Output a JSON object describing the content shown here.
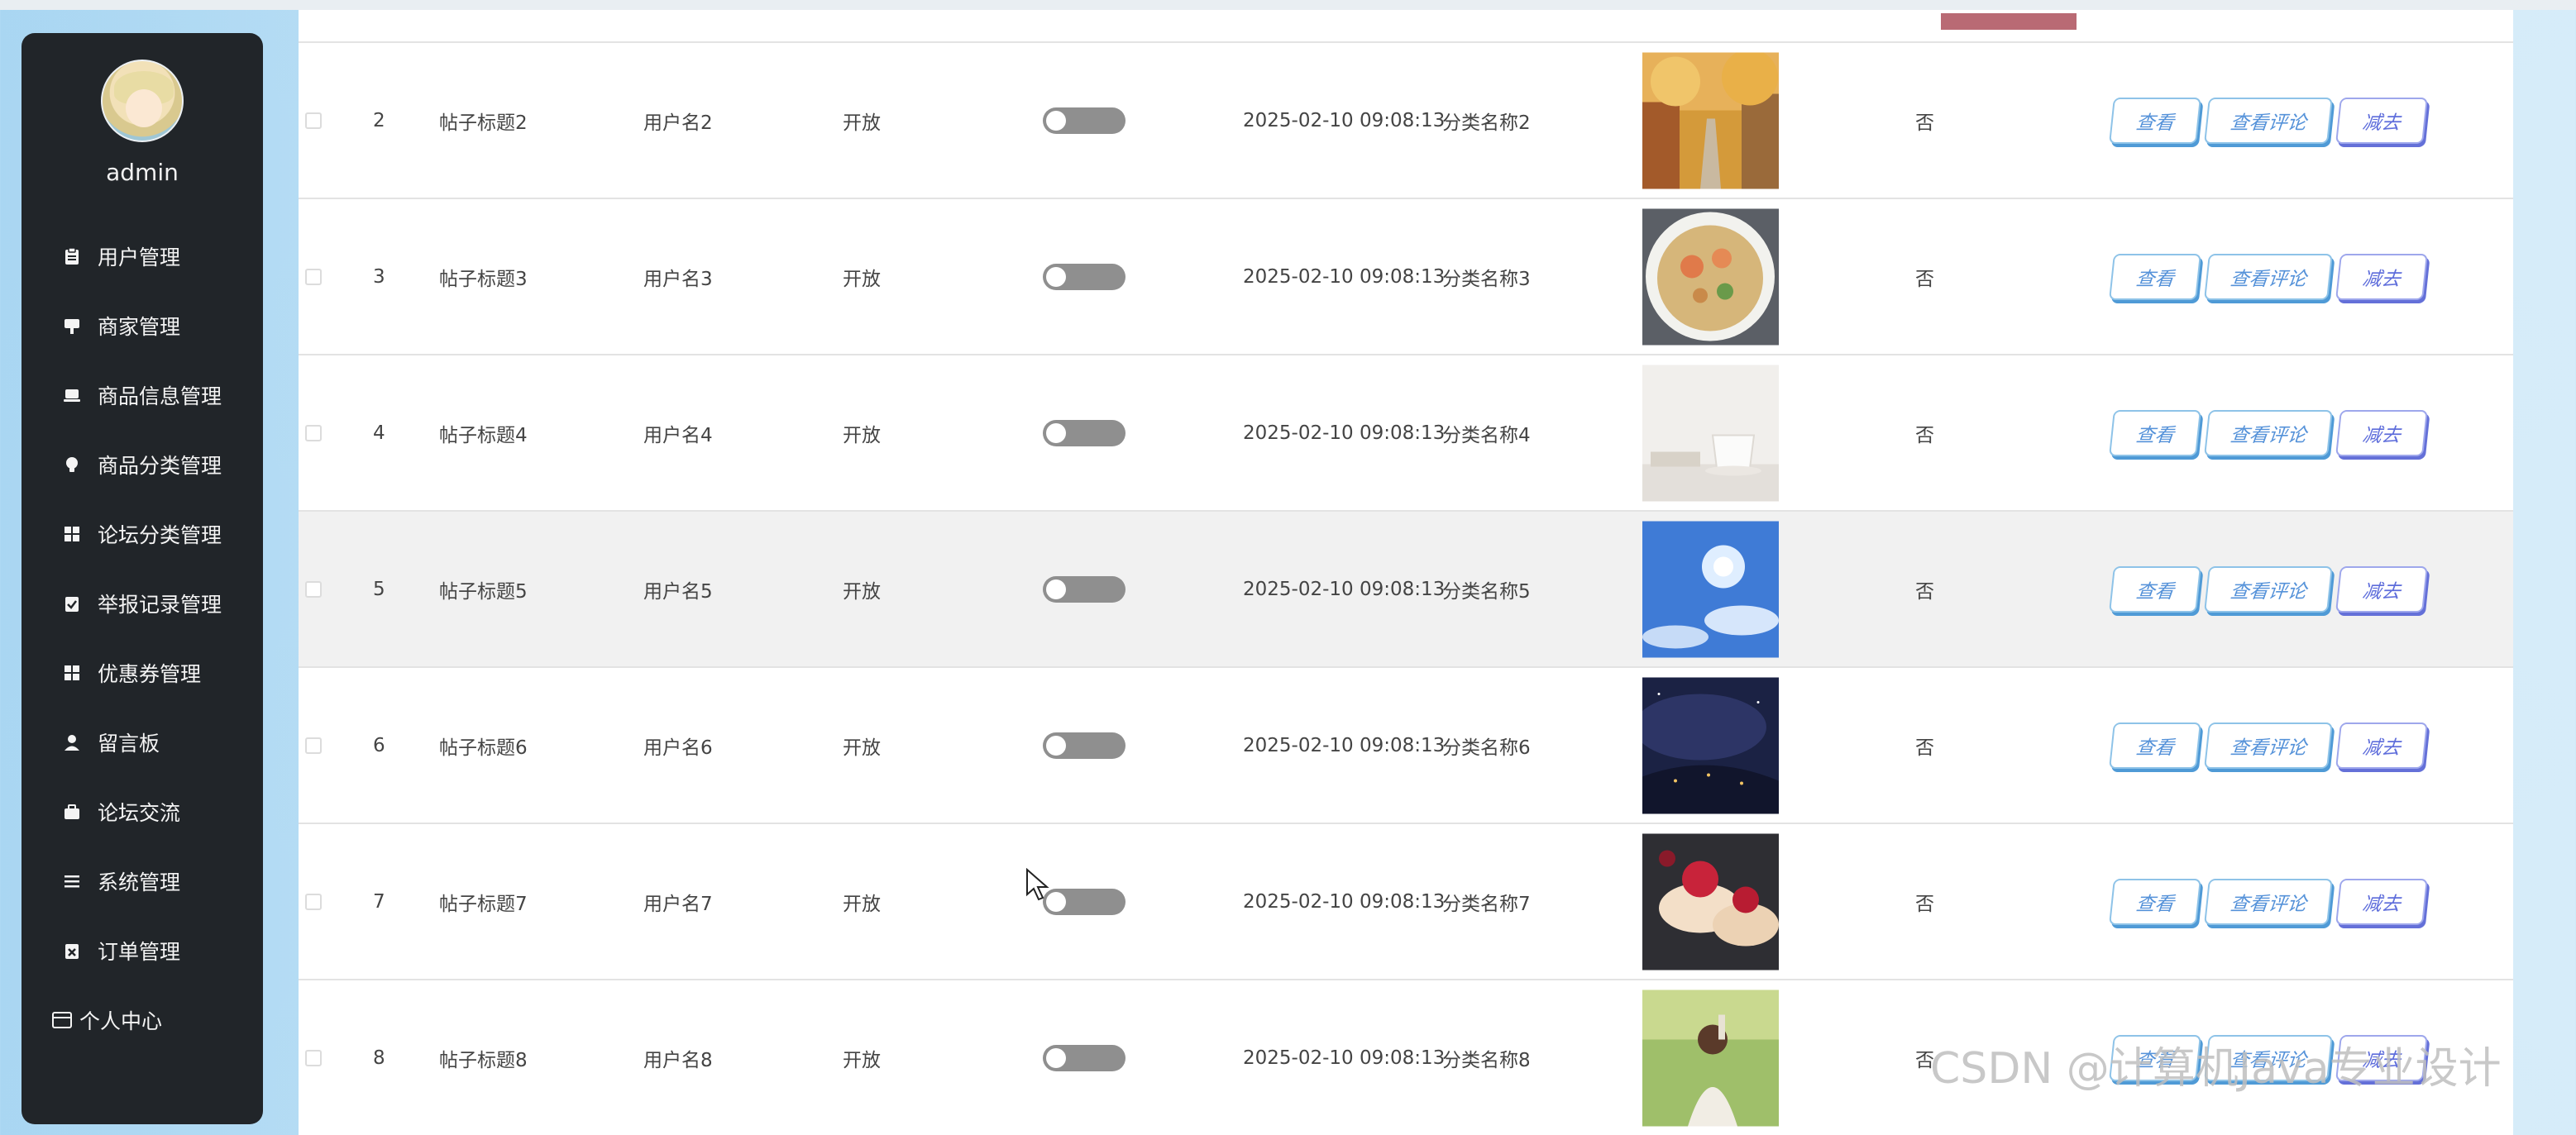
{
  "sidebar": {
    "username": "admin",
    "items": [
      {
        "label": "用户管理",
        "icon": "clipboard-icon"
      },
      {
        "label": "商家管理",
        "icon": "sign-icon"
      },
      {
        "label": "商品信息管理",
        "icon": "laptop-icon"
      },
      {
        "label": "商品分类管理",
        "icon": "bulb-icon"
      },
      {
        "label": "论坛分类管理",
        "icon": "grid-icon"
      },
      {
        "label": "举报记录管理",
        "icon": "clipboard-check-icon"
      },
      {
        "label": "优惠券管理",
        "icon": "grid-icon"
      },
      {
        "label": "留言板",
        "icon": "user-icon"
      },
      {
        "label": "论坛交流",
        "icon": "briefcase-icon"
      },
      {
        "label": "系统管理",
        "icon": "list-icon"
      },
      {
        "label": "订单管理",
        "icon": "clipboard-x-icon"
      },
      {
        "label": "个人中心",
        "icon": "window-icon"
      }
    ]
  },
  "table": {
    "button_labels": {
      "view": "查看",
      "comments": "查看评论",
      "minus": "减去"
    },
    "rows": [
      {
        "index": "2",
        "title": "帖子标题2",
        "user": "用户名2",
        "status": "开放",
        "toggle_on": false,
        "time": "2025-02-10 09:08:13",
        "category": "分类名称2",
        "image": "autumn-path",
        "pinned": "否"
      },
      {
        "index": "3",
        "title": "帖子标题3",
        "user": "用户名3",
        "status": "开放",
        "toggle_on": false,
        "time": "2025-02-10 09:08:13",
        "category": "分类名称3",
        "image": "noodle-bowl",
        "pinned": "否"
      },
      {
        "index": "4",
        "title": "帖子标题4",
        "user": "用户名4",
        "status": "开放",
        "toggle_on": false,
        "time": "2025-02-10 09:08:13",
        "category": "分类名称4",
        "image": "coffee-cup",
        "pinned": "否"
      },
      {
        "index": "5",
        "title": "帖子标题5",
        "user": "用户名5",
        "status": "开放",
        "toggle_on": false,
        "time": "2025-02-10 09:08:13",
        "category": "分类名称5",
        "image": "blue-sky",
        "pinned": "否"
      },
      {
        "index": "6",
        "title": "帖子标题6",
        "user": "用户名6",
        "status": "开放",
        "toggle_on": false,
        "time": "2025-02-10 09:08:13",
        "category": "分类名称6",
        "image": "night-space",
        "pinned": "否"
      },
      {
        "index": "7",
        "title": "帖子标题7",
        "user": "用户名7",
        "status": "开放",
        "toggle_on": false,
        "time": "2025-02-10 09:08:13",
        "category": "分类名称7",
        "image": "berry-cake",
        "pinned": "否"
      },
      {
        "index": "8",
        "title": "帖子标题8",
        "user": "用户名8",
        "status": "开放",
        "toggle_on": false,
        "time": "2025-02-10 09:08:13",
        "category": "分类名称8",
        "image": "girl-in-park",
        "pinned": "否"
      }
    ]
  },
  "watermark": "CSDN @计算机Java专业设计",
  "colors": {
    "sidebar_bg": "#212529",
    "btn_blue": "#5592d9",
    "btn_purple": "#5e6ddb",
    "toggle_off": "#8f8f8f"
  }
}
